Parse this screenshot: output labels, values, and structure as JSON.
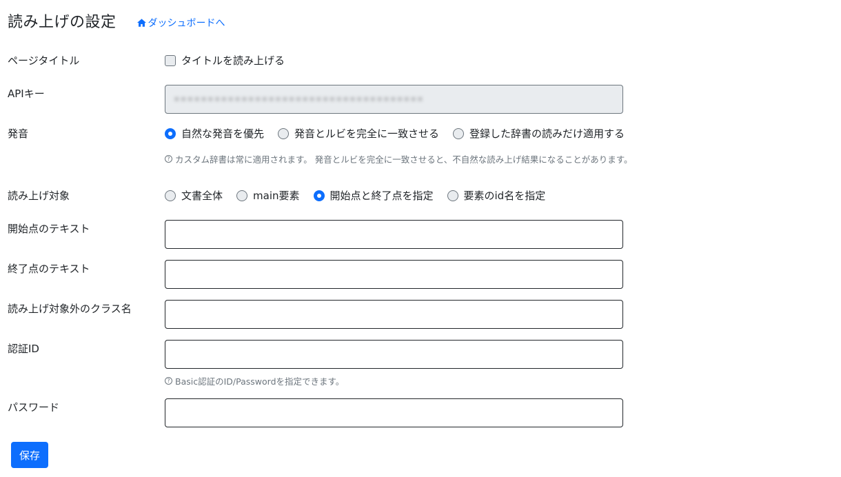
{
  "header": {
    "title": "読み上げの設定",
    "dashboard_link": "ダッシュボードへ"
  },
  "page_title_row": {
    "label": "ページタイトル",
    "checkbox_label": "タイトルを読み上げる"
  },
  "api_key_row": {
    "label": "APIキー",
    "masked_value": "▪▪▪▪▪▪▪▪▪▪▪▪▪▪▪▪▪▪▪▪▪▪▪▪▪▪▪▪▪▪▪▪▪▪▪▪▪"
  },
  "pronunciation_row": {
    "label": "発音",
    "options": [
      "自然な発音を優先",
      "発音とルビを完全に一致させる",
      "登録した辞書の読みだけ適用する"
    ],
    "selected": "自然な発音を優先",
    "help": "カスタム辞書は常に適用されます。 発音とルビを完全に一致させると、不自然な読み上げ結果になることがあります。"
  },
  "target_row": {
    "label": "読み上げ対象",
    "options": [
      "文書全体",
      "main要素",
      "開始点と終了点を指定",
      "要素のid名を指定"
    ],
    "selected": "開始点と終了点を指定"
  },
  "start_text_row": {
    "label": "開始点のテキスト",
    "value": ""
  },
  "end_text_row": {
    "label": "終了点のテキスト",
    "value": ""
  },
  "exclude_class_row": {
    "label": "読み上げ対象外のクラス名",
    "value": ""
  },
  "auth_id_row": {
    "label": "認証ID",
    "value": "",
    "help": "Basic認証のID/Passwordを指定できます。"
  },
  "password_row": {
    "label": "パスワード",
    "value": ""
  },
  "save_button": "保存",
  "colors": {
    "accent": "#0d6efd",
    "text": "#212529",
    "muted": "#6c757d",
    "disabled_bg": "#e9ecef"
  }
}
